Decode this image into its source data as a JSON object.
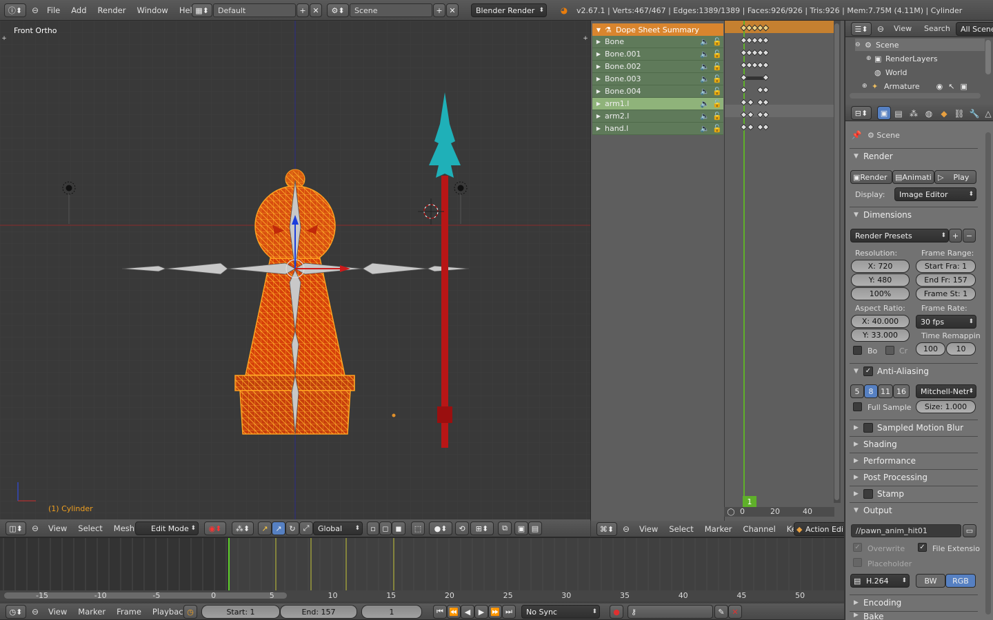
{
  "topbar": {
    "menus": [
      "File",
      "Add",
      "Render",
      "Window",
      "Help"
    ],
    "layout": "Default",
    "scene": "Scene",
    "engine": "Blender Render",
    "stats": "v2.67.1 | Verts:467/467 | Edges:1389/1389 | Faces:926/926 | Tris:926 | Mem:7.75M (4.11M) | Cylinder"
  },
  "viewport": {
    "title": "Front Ortho",
    "object_label": "(1) Cylinder",
    "header": {
      "menus": [
        "View",
        "Select",
        "Mesh"
      ],
      "mode": "Edit Mode",
      "orientation": "Global"
    }
  },
  "dopesheet": {
    "summary": "Dope Sheet Summary",
    "channels": [
      "Bone",
      "Bone.001",
      "Bone.002",
      "Bone.003",
      "Bone.004",
      "arm1.l",
      "arm2.l",
      "hand.l"
    ],
    "current_frame": "1",
    "ruler": [
      "0",
      "20",
      "40"
    ],
    "header": {
      "menus": [
        "View",
        "Select",
        "Marker",
        "Channel",
        "Key"
      ],
      "mode": "Action Edi"
    }
  },
  "outliner": {
    "menus": [
      "View",
      "Search"
    ],
    "filter": "All Scenes",
    "items": [
      "Scene",
      "RenderLayers",
      "World",
      "Armature"
    ]
  },
  "properties": {
    "context": "Scene",
    "render_panel": "Render",
    "render_btn": "Render",
    "anim_btn": "Animati",
    "play_btn": "Play",
    "display_label": "Display:",
    "display_value": "Image Editor",
    "dimensions": "Dimensions",
    "presets": "Render Presets",
    "resolution_label": "Resolution:",
    "res_x": "X: 720",
    "res_y": "Y: 480",
    "res_pct": "100%",
    "frame_range_label": "Frame Range:",
    "start_frame": "Start Fra: 1",
    "end_frame": "End Fr: 157",
    "frame_step": "Frame St: 1",
    "aspect_label": "Aspect Ratio:",
    "aspect_x": "X: 40.000",
    "aspect_y": "Y: 33.000",
    "frame_rate_label": "Frame Rate:",
    "fps": "30 fps",
    "time_remap_label": "Time Remappin",
    "border": "Bo",
    "crop": "Cr",
    "remap_old": "100",
    "remap_new": "10",
    "antialiasing": "Anti-Aliasing",
    "aa_samples": [
      "5",
      "8",
      "11",
      "16"
    ],
    "aa_filter": "Mitchell-Netr",
    "full_sample": "Full Sample",
    "aa_size": "Size: 1.000",
    "collapsed": [
      "Sampled Motion Blur",
      "Shading",
      "Performance",
      "Post Processing",
      "Stamp"
    ],
    "output": "Output",
    "output_path": "//pawn_anim_hit01",
    "overwrite": "Overwrite",
    "file_ext": "File Extensio",
    "placeholder": "Placeholder",
    "format": "H.264",
    "bw": "BW",
    "rgb": "RGB",
    "encoding": "Encoding",
    "bake": "Bake"
  },
  "timeline": {
    "ruler": [
      "-15",
      "-10",
      "-5",
      "0",
      "5",
      "10",
      "15",
      "20",
      "25",
      "30",
      "35",
      "40",
      "45",
      "50"
    ],
    "menus": [
      "View",
      "Marker",
      "Frame",
      "Playback"
    ],
    "start": "Start: 1",
    "end": "End: 157",
    "current": "1",
    "sync": "No Sync"
  }
}
